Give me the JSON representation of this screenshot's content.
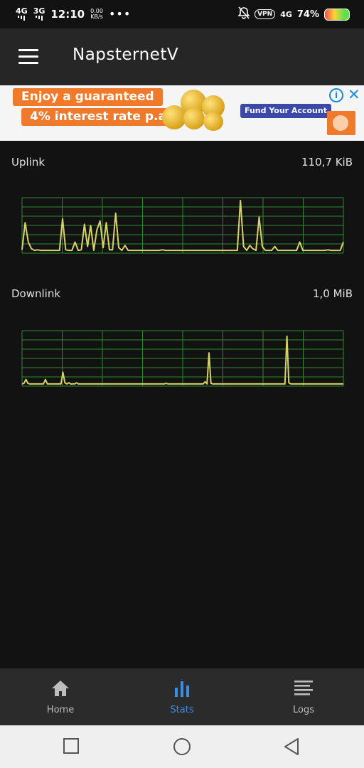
{
  "status_bar": {
    "net1": "4G",
    "net2": "3G",
    "time": "12:10",
    "speed_value": "0.00",
    "speed_unit": "KB/s",
    "more": "•••",
    "vpn": "VPN",
    "net3": "4G",
    "battery": "74%",
    "battery_level": 0.74
  },
  "toolbar": {
    "title": "NapsternetV",
    "menu_icon": "hamburger-menu-icon"
  },
  "ad": {
    "headline": "Enjoy a guaranteed",
    "subline": "4% interest rate p.a.",
    "cta": "Fund Your Account",
    "info_icon": "ad-info-icon",
    "close_icon": "ad-close-icon"
  },
  "stats": {
    "uplink_label": "Uplink",
    "uplink_value": "110,7  KiB",
    "downlink_label": "Downlink",
    "downlink_value": "1,0  MiB"
  },
  "chart_data": [
    {
      "type": "line",
      "title": "Uplink",
      "ylim": [
        0,
        1
      ],
      "grid": true,
      "values": [
        0.06,
        0.55,
        0.2,
        0.08,
        0.05,
        0.06,
        0.05,
        0.05,
        0.05,
        0.05,
        0.05,
        0.05,
        0.05,
        0.62,
        0.06,
        0.05,
        0.05,
        0.2,
        0.05,
        0.06,
        0.52,
        0.12,
        0.5,
        0.05,
        0.42,
        0.58,
        0.1,
        0.55,
        0.06,
        0.06,
        0.72,
        0.1,
        0.05,
        0.14,
        0.05,
        0.05,
        0.05,
        0.05,
        0.05,
        0.05,
        0.05,
        0.05,
        0.05,
        0.05,
        0.05,
        0.06,
        0.05,
        0.05,
        0.05,
        0.05,
        0.05,
        0.05,
        0.05,
        0.05,
        0.05,
        0.05,
        0.05,
        0.05,
        0.05,
        0.05,
        0.05,
        0.05,
        0.05,
        0.05,
        0.05,
        0.05,
        0.05,
        0.05,
        0.05,
        0.05,
        0.95,
        0.12,
        0.05,
        0.14,
        0.08,
        0.05,
        0.65,
        0.12,
        0.05,
        0.05,
        0.05,
        0.12,
        0.05,
        0.05,
        0.05,
        0.05,
        0.05,
        0.05,
        0.05,
        0.2,
        0.05,
        0.05,
        0.05,
        0.05,
        0.05,
        0.05,
        0.05,
        0.05,
        0.06,
        0.05,
        0.05,
        0.05,
        0.05,
        0.2
      ]
    },
    {
      "type": "line",
      "title": "Downlink",
      "ylim": [
        0,
        1
      ],
      "grid": true,
      "values": [
        0.04,
        0.05,
        0.12,
        0.05,
        0.04,
        0.04,
        0.04,
        0.04,
        0.04,
        0.04,
        0.04,
        0.04,
        0.12,
        0.04,
        0.04,
        0.04,
        0.04,
        0.04,
        0.04,
        0.04,
        0.04,
        0.25,
        0.06,
        0.04,
        0.06,
        0.04,
        0.04,
        0.04,
        0.06,
        0.04,
        0.04,
        0.04,
        0.04,
        0.04,
        0.04,
        0.04,
        0.04,
        0.04,
        0.04,
        0.04,
        0.04,
        0.04,
        0.04,
        0.04,
        0.04,
        0.04,
        0.04,
        0.04,
        0.04,
        0.04,
        0.04,
        0.04,
        0.04,
        0.04,
        0.04,
        0.04,
        0.04,
        0.04,
        0.04,
        0.04,
        0.04,
        0.04,
        0.04,
        0.04,
        0.04,
        0.04,
        0.04,
        0.04,
        0.04,
        0.04,
        0.04,
        0.04,
        0.04,
        0.04,
        0.05,
        0.04,
        0.04,
        0.04,
        0.04,
        0.04,
        0.04,
        0.04,
        0.04,
        0.04,
        0.04,
        0.04,
        0.04,
        0.04,
        0.04,
        0.04,
        0.04,
        0.04,
        0.04,
        0.04,
        0.08,
        0.04,
        0.6,
        0.05,
        0.04,
        0.04,
        0.04,
        0.04,
        0.04,
        0.04,
        0.04,
        0.04,
        0.04,
        0.04,
        0.04,
        0.04,
        0.04,
        0.04,
        0.04,
        0.04,
        0.04,
        0.04,
        0.04,
        0.04,
        0.04,
        0.04,
        0.04,
        0.04,
        0.04,
        0.04,
        0.04,
        0.04,
        0.04,
        0.04,
        0.04,
        0.04,
        0.04,
        0.04,
        0.04,
        0.04,
        0.04,
        0.04,
        0.9,
        0.06,
        0.04,
        0.04,
        0.04,
        0.04,
        0.04,
        0.04,
        0.04,
        0.04,
        0.04,
        0.04,
        0.04,
        0.04,
        0.04,
        0.04,
        0.04,
        0.04,
        0.04,
        0.04,
        0.04,
        0.04,
        0.04,
        0.04,
        0.04,
        0.04,
        0.04,
        0.04,
        0.04,
        0.04
      ]
    }
  ],
  "bottom_nav": {
    "items": [
      {
        "label": "Home",
        "icon": "home-icon"
      },
      {
        "label": "Stats",
        "icon": "bar-chart-icon",
        "active": true
      },
      {
        "label": "Logs",
        "icon": "logs-list-icon"
      }
    ]
  },
  "system_nav": {
    "recents_icon": "recents-square-icon",
    "home_icon": "home-circle-icon",
    "back_icon": "back-triangle-icon"
  },
  "colors": {
    "background": "#121212",
    "toolbar": "#262626",
    "grid": "#2e8b2e",
    "trace": "#d8d26a",
    "accent": "#3a8ee6"
  }
}
